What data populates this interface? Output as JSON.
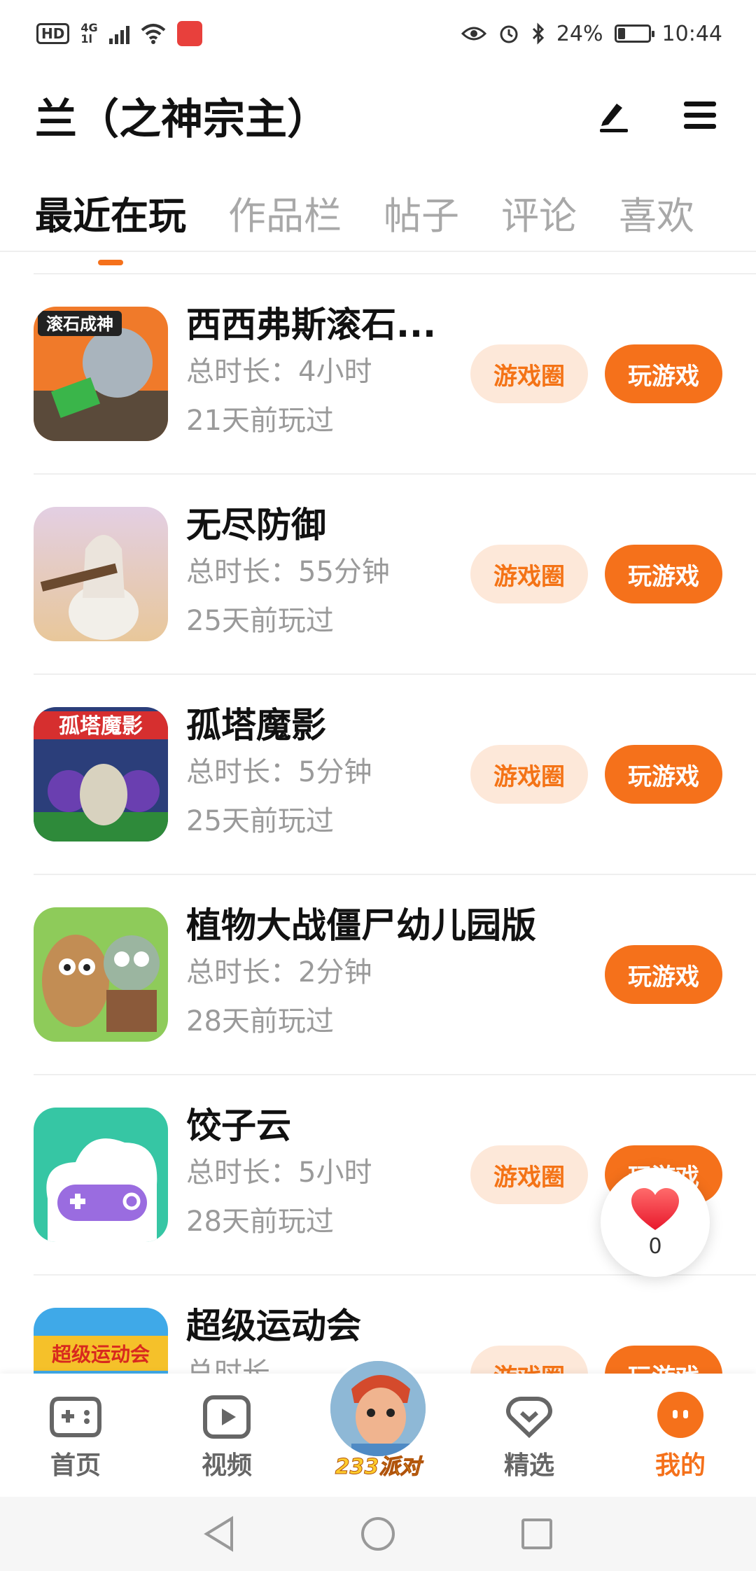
{
  "status": {
    "hd": "HD",
    "net_top": "4G",
    "net_bottom": "1l",
    "battery": "24%",
    "battery_level": 0.24,
    "time": "10:44"
  },
  "header": {
    "title": "兰（之神宗主）"
  },
  "tabs": [
    {
      "label": "最近在玩",
      "active": true
    },
    {
      "label": "作品栏"
    },
    {
      "label": "帖子"
    },
    {
      "label": "评论"
    },
    {
      "label": "喜欢"
    }
  ],
  "games": [
    {
      "name": "西西弗斯滚石...",
      "duration": "总时长：4小时",
      "last": "21天前玩过",
      "circle": "游戏圈",
      "play": "玩游戏",
      "thumb_text": "滚石成神"
    },
    {
      "name": "无尽防御",
      "duration": "总时长：55分钟",
      "last": "25天前玩过",
      "circle": "游戏圈",
      "play": "玩游戏",
      "thumb_text": ""
    },
    {
      "name": "孤塔魔影",
      "duration": "总时长：5分钟",
      "last": "25天前玩过",
      "circle": "游戏圈",
      "play": "玩游戏",
      "thumb_text": "孤塔魔影"
    },
    {
      "name": "植物大战僵尸幼儿园版",
      "duration": "总时长：2分钟",
      "last": "28天前玩过",
      "circle": "",
      "play": "玩游戏",
      "thumb_text": ""
    },
    {
      "name": "饺子云",
      "duration": "总时长：5小时",
      "last": "28天前玩过",
      "circle": "游戏圈",
      "play": "玩游戏",
      "thumb_text": ""
    },
    {
      "name": "超级运动会",
      "duration": "总时长",
      "last": "",
      "circle": "游戏圈",
      "play": "玩游戏",
      "thumb_text": "超级运动会"
    }
  ],
  "like": {
    "count": "0"
  },
  "nav": {
    "home": "首页",
    "video": "视频",
    "party": "233派对",
    "featured": "精选",
    "mine": "我的"
  },
  "colors": {
    "accent": "#f5711b",
    "accent_light": "#fde8d9"
  }
}
